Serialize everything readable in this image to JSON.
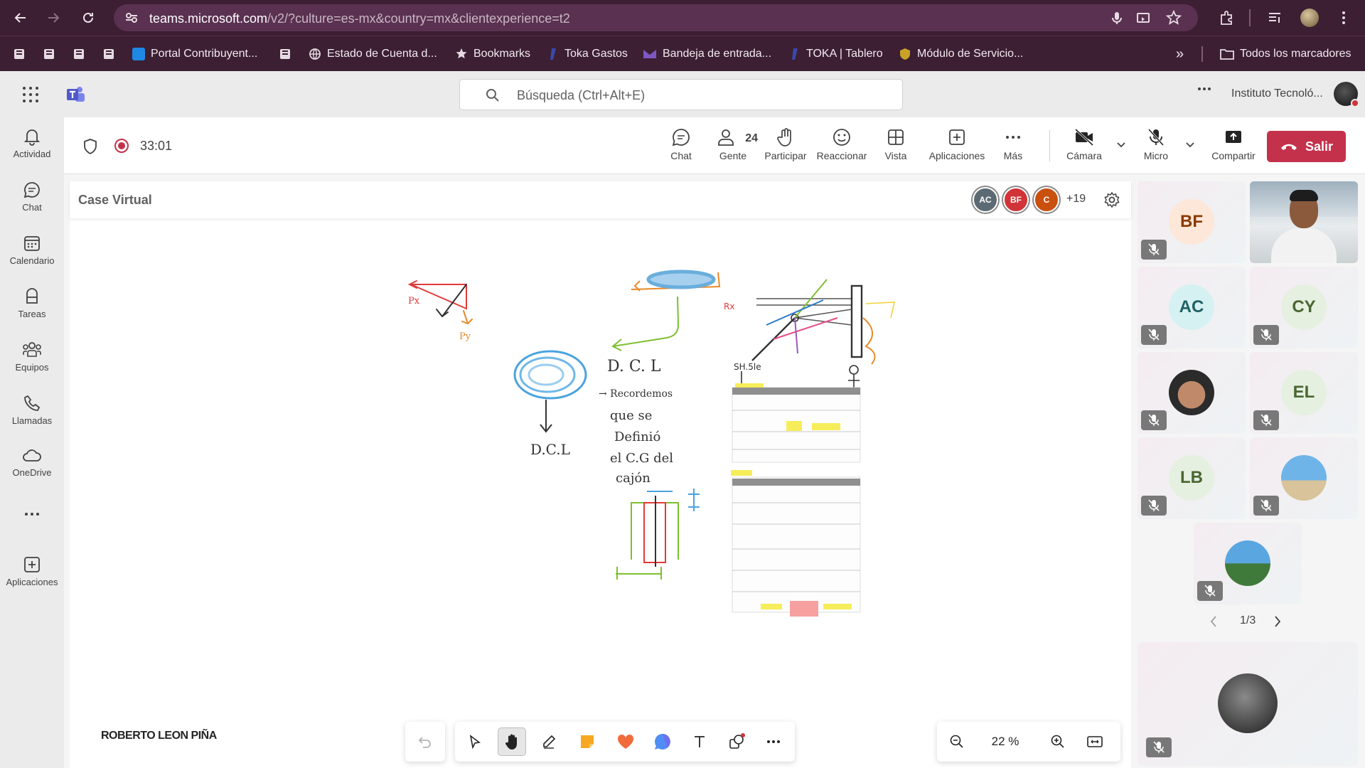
{
  "browser": {
    "url_host": "teams.microsoft.com",
    "url_rest": "/v2/?culture=es-mx&country=mx&clientexperience=t2",
    "bookmarks": [
      {
        "label": "Portal Contribuyent...",
        "color": "#1e88e5"
      },
      {
        "label": "Estado de Cuenta d...",
        "color": "#9e9e9e"
      },
      {
        "label": "Bookmarks",
        "color": "#e0e0e0"
      },
      {
        "label": "Toka Gastos",
        "color": "#3949ab"
      },
      {
        "label": "Bandeja de entrada...",
        "color": "#7e57c2"
      },
      {
        "label": "TOKA | Tablero",
        "color": "#3949ab"
      },
      {
        "label": "Módulo de Servicio...",
        "color": "#c9a227"
      }
    ],
    "all_bookmarks": "Todos los marcadores",
    "more_bookmarks": "»"
  },
  "teams": {
    "search_placeholder": "Búsqueda (Ctrl+Alt+E)",
    "org_name": "Instituto Tecnoló...",
    "rail": [
      {
        "label": "Actividad",
        "icon": "bell-icon"
      },
      {
        "label": "Chat",
        "icon": "chat-icon"
      },
      {
        "label": "Calendario",
        "icon": "calendar-icon"
      },
      {
        "label": "Tareas",
        "icon": "tasks-icon"
      },
      {
        "label": "Equipos",
        "icon": "teams-icon"
      },
      {
        "label": "Llamadas",
        "icon": "phone-icon"
      },
      {
        "label": "OneDrive",
        "icon": "cloud-icon"
      },
      {
        "label": "...",
        "icon": "more-icon"
      },
      {
        "label": "Aplicaciones",
        "icon": "add-apps-icon"
      }
    ]
  },
  "meeting": {
    "timer": "33:01",
    "people_count": "24",
    "buttons": {
      "chat": "Chat",
      "people": "Gente",
      "raise": "Participar",
      "react": "Reaccionar",
      "view": "Vista",
      "apps": "Aplicaciones",
      "more": "Más",
      "camera": "Cámara",
      "mic": "Micro",
      "share": "Compartir",
      "leave": "Salir"
    }
  },
  "whiteboard": {
    "title": "Case Virtual",
    "avatars": [
      {
        "initials": "AC",
        "color": "#5c6b73"
      },
      {
        "initials": "BF",
        "color": "#d13438"
      },
      {
        "initials": "C",
        "color": "#ca5010"
      }
    ],
    "extra_count": "+19",
    "zoom": "22 %",
    "presenter": "ROBERTO LEON PIÑA",
    "handwriting": {
      "dcl_1": "D. C. L",
      "dcl_2": "D.C.L",
      "note_1": "→ Recordemos",
      "note_2": "que se",
      "note_3": "Definió",
      "note_4": "el C.G del",
      "note_5": "cajón",
      "px": "Px",
      "py": "Py",
      "sh": "SH.5le"
    }
  },
  "participants": {
    "tiles": [
      {
        "initials": "BF",
        "bg": "#fde7d8",
        "fg": "#8a3a00"
      },
      {
        "initials": "",
        "bg": "",
        "fg": ""
      },
      {
        "initials": "AC",
        "bg": "#d6f1f2",
        "fg": "#1f5f63"
      },
      {
        "initials": "CY",
        "bg": "#e6f0e0",
        "fg": "#4a6632"
      },
      {
        "initials": "",
        "bg": "",
        "fg": ""
      },
      {
        "initials": "EL",
        "bg": "#e6f0e0",
        "fg": "#4a6632"
      },
      {
        "initials": "LB",
        "bg": "#e6f0e0",
        "fg": "#4a6632"
      },
      {
        "initials": "",
        "bg": "",
        "fg": ""
      },
      {
        "initials": "",
        "bg": "",
        "fg": ""
      }
    ],
    "pager": "1/3"
  }
}
